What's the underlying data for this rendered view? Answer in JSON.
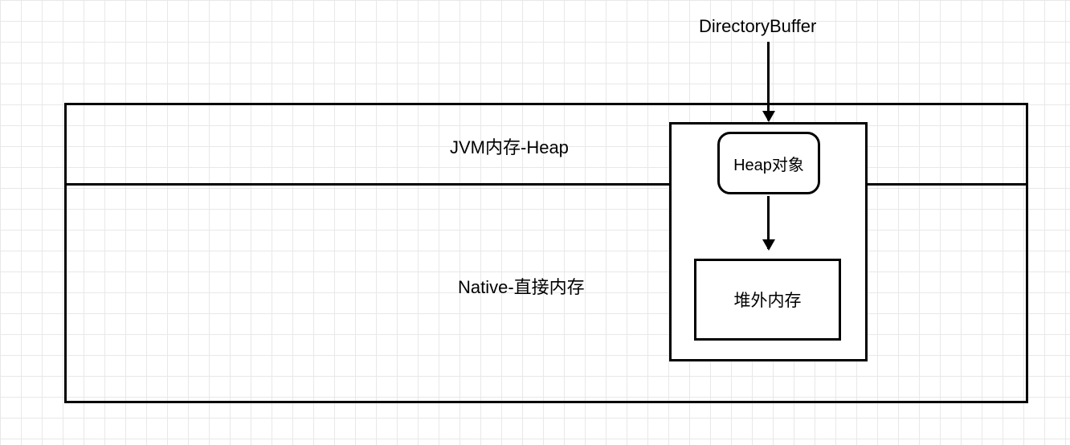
{
  "labels": {
    "directoryBuffer": "DirectoryBuffer",
    "jvmHeap": "JVM内存-Heap",
    "native": "Native-直接内存",
    "heapObject": "Heap对象",
    "offHeapMemory": "堆外内存"
  }
}
